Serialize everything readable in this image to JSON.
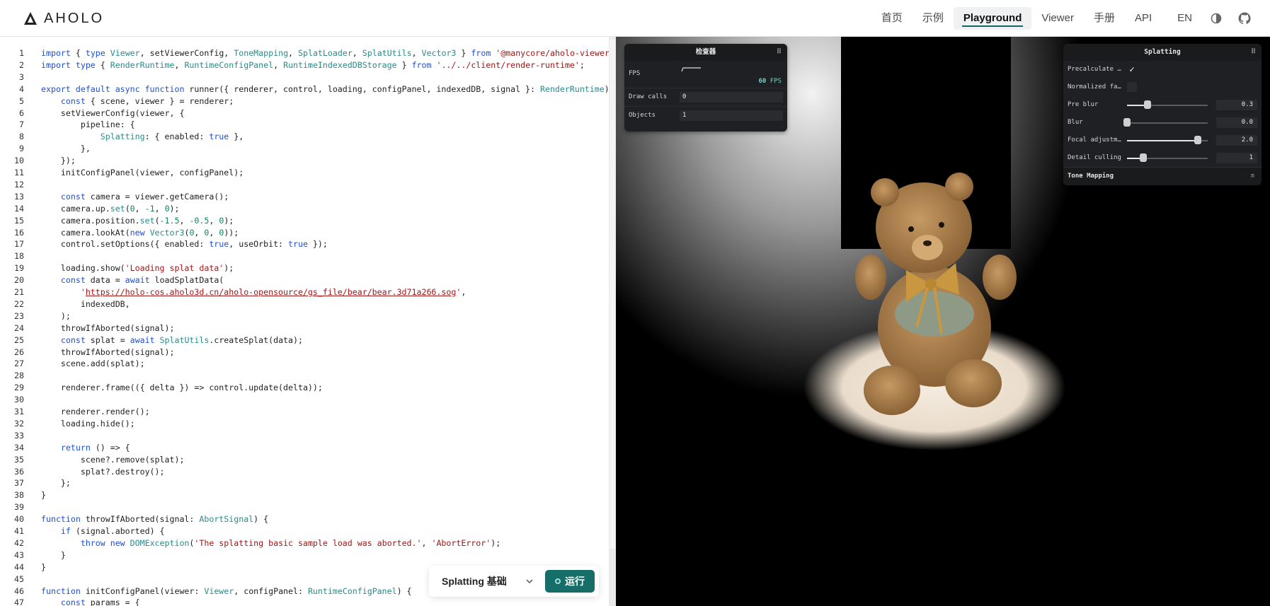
{
  "header": {
    "brand": "AHOLO",
    "nav": [
      {
        "label": "首页",
        "active": false
      },
      {
        "label": "示例",
        "active": false
      },
      {
        "label": "Playground",
        "active": true
      },
      {
        "label": "Viewer",
        "active": false
      },
      {
        "label": "手册",
        "active": false
      },
      {
        "label": "API",
        "active": false
      },
      {
        "label": "EN",
        "active": false
      }
    ],
    "icons": [
      "theme-toggle-icon",
      "github-icon"
    ]
  },
  "editor": {
    "lines": [
      {
        "n": "1",
        "html": "<span class=\"k\">import</span> { <span class=\"k\">type</span> <span class=\"t\">Viewer</span>, setViewerConfig, <span class=\"t\">ToneMapping</span>, <span class=\"t\">SplatLoader</span>, <span class=\"t\">SplatUtils</span>, <span class=\"t\">Vector3</span> } <span class=\"k\">from</span> <span class=\"s\">'@manycore/aholo-viewer'</span>;"
      },
      {
        "n": "2",
        "html": "<span class=\"k\">import type</span> { <span class=\"t\">RenderRuntime</span>, <span class=\"t\">RuntimeConfigPanel</span>, <span class=\"t\">RuntimeIndexedDBStorage</span> } <span class=\"k\">from</span> <span class=\"s\">'../../client/render-runtime'</span>;"
      },
      {
        "n": "3",
        "html": ""
      },
      {
        "n": "4",
        "html": "<span class=\"k\">export default async function</span> runner({ renderer, control, loading, configPanel, indexedDB, signal }: <span class=\"t\">RenderRuntime</span>) {"
      },
      {
        "n": "5",
        "html": "    <span class=\"k\">const</span> { scene, viewer } = renderer;"
      },
      {
        "n": "6",
        "html": "    setViewerConfig(viewer, {"
      },
      {
        "n": "7",
        "html": "        pipeline: {"
      },
      {
        "n": "8",
        "html": "            <span class=\"t\">Splatting</span>: { enabled: <span class=\"k\">true</span> },"
      },
      {
        "n": "9",
        "html": "        },"
      },
      {
        "n": "10",
        "html": "    });"
      },
      {
        "n": "11",
        "html": "    initConfigPanel(viewer, configPanel);"
      },
      {
        "n": "12",
        "html": ""
      },
      {
        "n": "13",
        "html": "    <span class=\"k\">const</span> camera = viewer.getCamera();"
      },
      {
        "n": "14",
        "html": "    camera.up.<span class=\"t\">set</span>(<span class=\"n\">0</span>, <span class=\"n\">-1</span>, <span class=\"n\">0</span>);"
      },
      {
        "n": "15",
        "html": "    camera.position.<span class=\"t\">set</span>(<span class=\"n\">-1.5</span>, <span class=\"n\">-0.5</span>, <span class=\"n\">0</span>);"
      },
      {
        "n": "16",
        "html": "    camera.lookAt(<span class=\"k\">new</span> <span class=\"t\">Vector3</span>(<span class=\"n\">0</span>, <span class=\"n\">0</span>, <span class=\"n\">0</span>));"
      },
      {
        "n": "17",
        "html": "    control.setOptions({ enabled: <span class=\"k\">true</span>, useOrbit: <span class=\"k\">true</span> });"
      },
      {
        "n": "18",
        "html": ""
      },
      {
        "n": "19",
        "html": "    loading.show(<span class=\"s\">'Loading splat data'</span>);"
      },
      {
        "n": "20",
        "html": "    <span class=\"k\">const</span> data = <span class=\"k\">await</span> loadSplatData("
      },
      {
        "n": "21",
        "html": "        <span class=\"s\">'<span class=\"lnk\">https://holo-cos.aholo3d.cn/aholo-opensource/gs_file/bear/bear.3d71a266.sog</span>'</span>,"
      },
      {
        "n": "22",
        "html": "        indexedDB,"
      },
      {
        "n": "23",
        "html": "    );"
      },
      {
        "n": "24",
        "html": "    throwIfAborted(signal);"
      },
      {
        "n": "25",
        "html": "    <span class=\"k\">const</span> splat = <span class=\"k\">await</span> <span class=\"t\">SplatUtils</span>.createSplat(data);"
      },
      {
        "n": "26",
        "html": "    throwIfAborted(signal);"
      },
      {
        "n": "27",
        "html": "    scene.add(splat);"
      },
      {
        "n": "28",
        "html": ""
      },
      {
        "n": "29",
        "html": "    renderer.frame(({ delta }) => control.update(delta));"
      },
      {
        "n": "30",
        "html": ""
      },
      {
        "n": "31",
        "html": "    renderer.render();"
      },
      {
        "n": "32",
        "html": "    loading.hide();"
      },
      {
        "n": "33",
        "html": ""
      },
      {
        "n": "34",
        "html": "    <span class=\"k\">return</span> () => {"
      },
      {
        "n": "35",
        "html": "        scene?.remove(splat);"
      },
      {
        "n": "36",
        "html": "        splat?.destroy();"
      },
      {
        "n": "37",
        "html": "    };"
      },
      {
        "n": "38",
        "html": "}"
      },
      {
        "n": "39",
        "html": ""
      },
      {
        "n": "40",
        "html": "<span class=\"k\">function</span> throwIfAborted(signal: <span class=\"t\">AbortSignal</span>) {"
      },
      {
        "n": "41",
        "html": "    <span class=\"k\">if</span> (signal.aborted) {"
      },
      {
        "n": "42",
        "html": "        <span class=\"k\">throw new</span> <span class=\"t\">DOMException</span>(<span class=\"s\">'The splatting basic sample load was aborted.'</span>, <span class=\"s\">'AbortError'</span>);"
      },
      {
        "n": "43",
        "html": "    }"
      },
      {
        "n": "44",
        "html": "}"
      },
      {
        "n": "45",
        "html": ""
      },
      {
        "n": "46",
        "html": "<span class=\"k\">function</span> initConfigPanel(viewer: <span class=\"t\">Viewer</span>, configPanel: <span class=\"t\">RuntimeConfigPanel</span>) {"
      },
      {
        "n": "47",
        "html": "    <span class=\"k\">const</span> params = {"
      }
    ]
  },
  "runbar": {
    "sample_label": "Splatting 基础",
    "run_label": "运行"
  },
  "inspector": {
    "title": "检查器",
    "fps_label": "FPS",
    "fps_value": "60",
    "fps_unit": "FPS",
    "draw_calls_label": "Draw calls",
    "draw_calls_value": "0",
    "objects_label": "Objects",
    "objects_value": "1"
  },
  "splatting": {
    "title": "Splatting",
    "precalculate_label": "Precalculate …",
    "precalculate_checked": true,
    "normalized_label": "Normalized fa…",
    "normalized_checked": false,
    "sliders": [
      {
        "label": "Pre blur",
        "value": "0.3",
        "fraction": 0.25
      },
      {
        "label": "Blur",
        "value": "0.0",
        "fraction": 0.0
      },
      {
        "label": "Focal adjustm…",
        "value": "2.0",
        "fraction": 0.88
      },
      {
        "label": "Detail culling",
        "value": "1",
        "fraction": 0.2
      }
    ],
    "tone_mapping_label": "Tone Mapping"
  }
}
